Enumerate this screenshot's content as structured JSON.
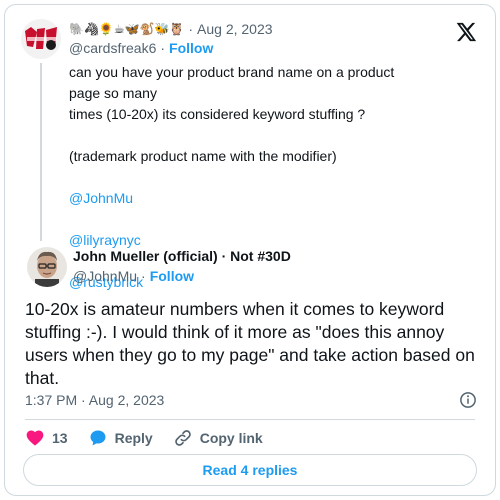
{
  "parent_tweet": {
    "display_name_emoji": "🐘🦓🌻☕🦋🐒🐝🦉",
    "date": "Aug 2, 2023",
    "handle": "@cardsfreak6",
    "follow_label": "Follow",
    "text_lines": [
      "can you have your product brand name on a product page so many",
      "times (10-20x)  its considered keyword stuffing ?"
    ],
    "text_paren": "(trademark product name with the modifier)",
    "mentions": [
      "@JohnMu",
      "@lilyraynyc",
      "@rustybrick"
    ]
  },
  "main_tweet": {
    "display_name": "John Mueller (official) · Not #30D",
    "handle": "@JohnMu",
    "follow_label": "Follow",
    "text": "10-20x is amateur numbers when it comes to keyword stuffing :-). I would think of it more as \"does this annoy users when they go to my page\" and take action based on that.",
    "timestamp": "1:37 PM · Aug 2, 2023",
    "like_count": "13",
    "reply_label": "Reply",
    "copy_link_label": "Copy link",
    "read_replies_label": "Read 4 replies"
  },
  "separator": "·",
  "colors": {
    "accent": "#1d9bf0",
    "text": "#0f1419",
    "muted": "#536471",
    "like": "#f91880",
    "border": "#cfd9de"
  },
  "icons": [
    "x-logo-icon",
    "info-icon",
    "heart-icon",
    "reply-bubble-icon",
    "link-icon"
  ]
}
